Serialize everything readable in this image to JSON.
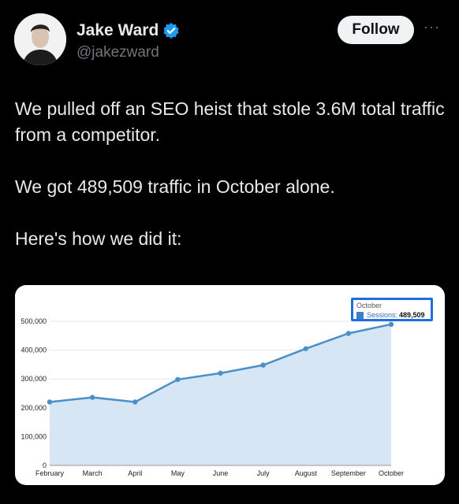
{
  "author": {
    "name": "Jake Ward",
    "handle": "@jakezward",
    "verified": true,
    "verified_color": "#1d9bf0"
  },
  "actions": {
    "follow_label": "Follow",
    "more_label": "···"
  },
  "tweet": {
    "paragraphs": [
      "We pulled off an SEO heist that stole 3.6M total traffic from a competitor.",
      "We got 489,509 traffic in October alone.",
      "Here's how we did it:"
    ]
  },
  "tooltip": {
    "month": "October",
    "label": "Sessions:",
    "value": "489,509"
  },
  "chart_data": {
    "type": "area",
    "categories": [
      "February",
      "March",
      "April",
      "May",
      "June",
      "July",
      "August",
      "September",
      "October"
    ],
    "series": [
      {
        "name": "Sessions",
        "values": [
          220000,
          236000,
          220000,
          298000,
          320000,
          348000,
          405000,
          458000,
          489509
        ]
      }
    ],
    "y_ticks": [
      "0",
      "100,000",
      "200,000",
      "300,000",
      "400,000",
      "500,000"
    ],
    "ylim": [
      0,
      500000
    ],
    "grid": true,
    "line_color": "#4a90c8",
    "fill_color": "#d6e6f4"
  }
}
